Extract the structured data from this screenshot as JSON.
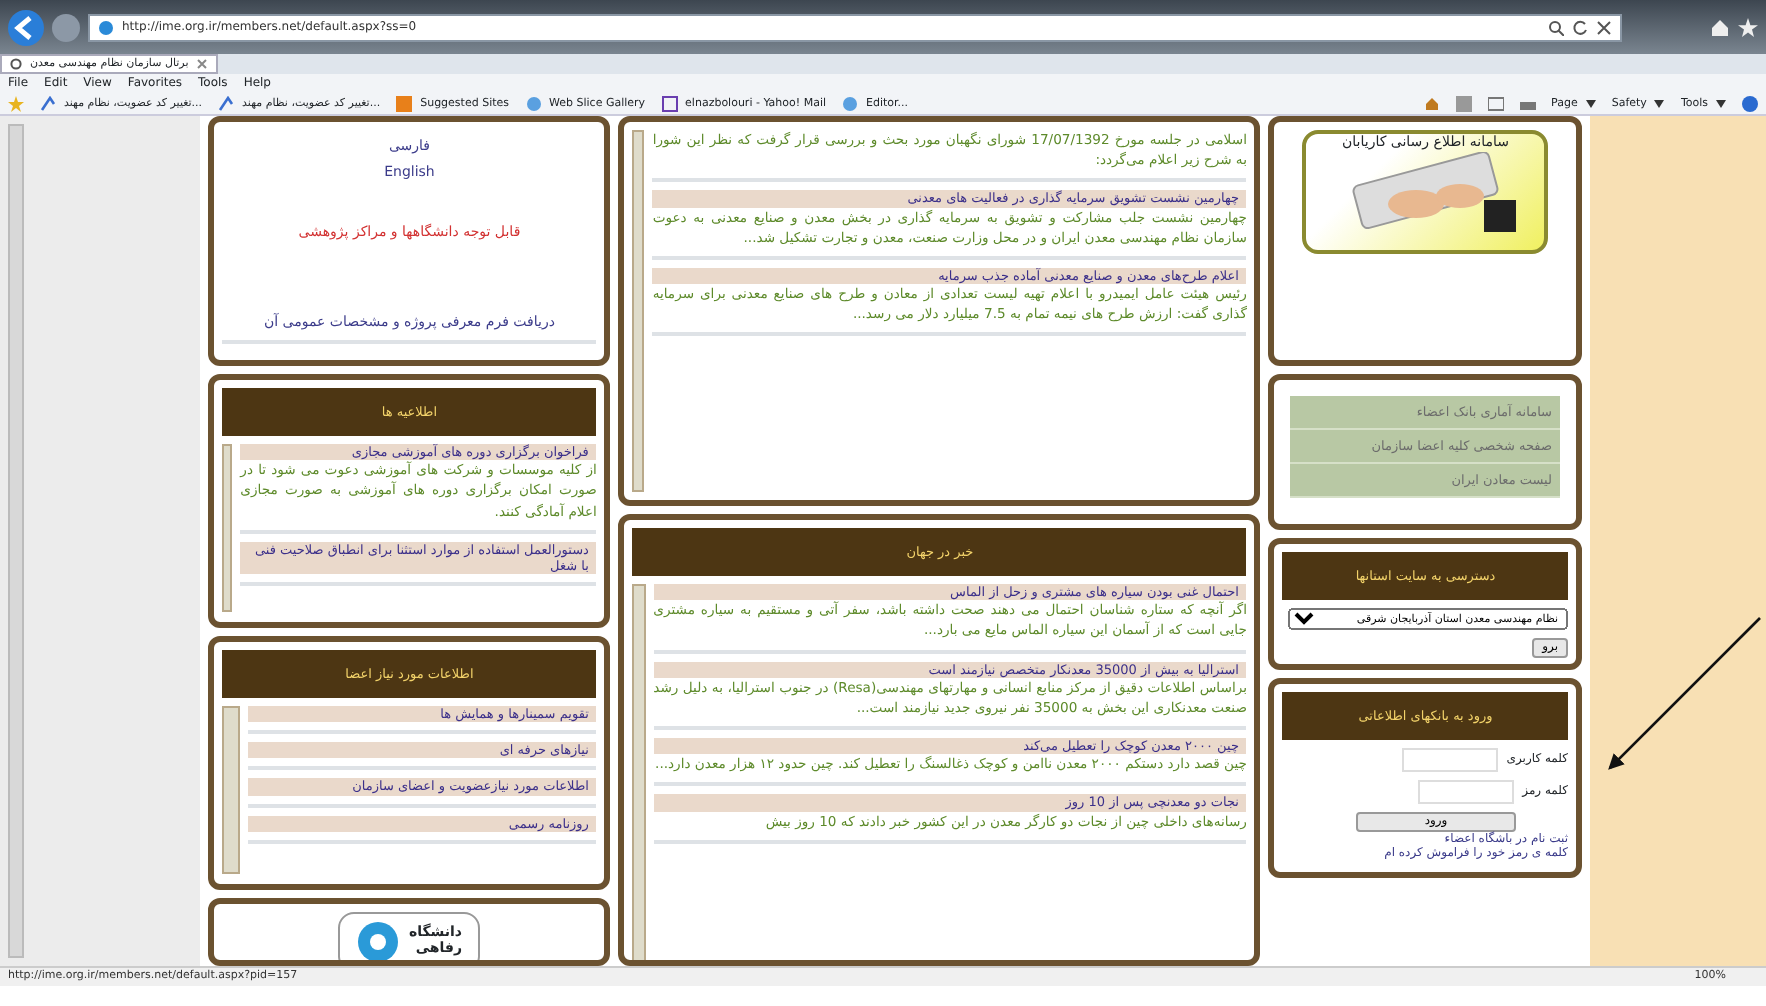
{
  "browser": {
    "address": "http://ime.org.ir/members.net/default.aspx?ss=0",
    "tab_title": "برتال سازمان نظام مهندسی معدن",
    "menu": [
      "Help",
      "Tools",
      "Favorites",
      "View",
      "Edit",
      "File"
    ],
    "favorites": [
      "Editor...",
      "elnazbolouri - Yahoo! Mail",
      "Web Slice Gallery",
      "Suggested Sites",
      "...تغییر کد عضویت، نظام مهند",
      "...تغییر کد عضویت، نظام مهند"
    ],
    "command_bar": [
      "Tools",
      "Safety",
      "Page"
    ],
    "status_url": "http://ime.org.ir/members.net/default.aspx?pid=157",
    "zoom": "100%"
  },
  "left_column": {
    "links": [
      {
        "text": "فارسی",
        "kind": "plain"
      },
      {
        "text": "English",
        "kind": "plain"
      },
      {
        "text": "قابل توجه دانشگاهها و مراکز پژوهشی",
        "kind": "alert"
      },
      {
        "text": "دریافت فرم معرفی پروژه و مشخصات عمومی آن",
        "kind": "plain"
      }
    ],
    "notices": {
      "title": "اطلاعیه ها",
      "items": [
        {
          "title": "فراخوان برگزاری دوره های آموزشی مجازی",
          "body": "از کلیه موسسات و شرکت های آموزشی دعوت می شود تا در صورت امکان برگزاری دوره های آموزشی به صورت مجازی اعلام آمادگی کنند."
        },
        {
          "title": "دستورالعمل استفاده از موارد استثنا برای انطباق صلاحیت فنی با شغل"
        }
      ]
    },
    "members": {
      "title": "اطلاعات مورد نیاز اعضا",
      "items": [
        "تقویم سمینارها و همایش ها",
        "نیازهای حرفه ای",
        "اطلاعات مورد نیازعضویت و اعضای سازمان",
        "روزنامه رسمی"
      ]
    },
    "logo_text": [
      "دانشگاه",
      "رفاهی"
    ]
  },
  "middle_column": {
    "news": {
      "items": [
        {
          "body": "اسلامی در جلسه مورخ 17/07/1392 شورای نگهبان مورد بحث و بررسی قرار گرفت که نظر این شورا به شرح زیر اعلام می‌گردد:"
        },
        {
          "title": "چهارمین نشست تشویق سرمایه گذاری در فعالیت های معدنی",
          "body": "چهارمین نشست جلب مشارکت و تشویق به سرمایه گذاری در بخش معدن و صنایع معدنی به دعوت سازمان نظام مهندسی معدن ایران و در محل وزارت صنعت، معدن و تجارت تشکیل شد..."
        },
        {
          "title": "اعلام طرح‌های معدن و صنایع معدنی آماده جذب سرمایه",
          "body": "رئیس هیئت عامل ایمیدرو با اعلام تهیه لیست تعدادی از معادن و طرح های صنایع معدنی برای سرمایه گذاری گفت: ارزش طرح های نیمه تمام به 7.5 میلیارد دلار می رسد..."
        }
      ]
    },
    "world_news": {
      "title": "خبر در جهان",
      "items": [
        {
          "title": "احتمال غنی بودن سیاره های مشتری و زحل از الماس",
          "body": "اگر آنچه که ستاره شناسان احتمال می دهند صحت داشته باشد، سفر آتی و مستقیم به سیاره مشتری جایی است که از آسمان این سیاره الماس مایع می بارد..."
        },
        {
          "title": "استرالیا به بیش از 35000 معدنکار متخصص نیازمند است",
          "body": "براساس اطلاعات دقیق از مرکز منابع انسانی و مهارتهای مهندسی(Resa) در جنوب استرالیا، به دلیل رشد صنعت معدنکاری این بخش به 35000 نفر نیروی جدید نیازمند است..."
        },
        {
          "title": "چین ۲۰۰۰ معدن کوچک را تعطیل می‌کند",
          "body": "چین قصد دارد دستکم ۲۰۰۰ معدن ناامن و کوچک ذغالسنگ را تعطیل کند. چین حدود ۱۲ هزار معدن دارد..."
        },
        {
          "title": "نجات دو معدنچی پس از 10 روز",
          "body": "رسانه‌های داخلی چین از نجات دو کارگر معدن در این کشور خبر دادند که 10 روز بیش"
        }
      ]
    }
  },
  "right_column": {
    "banner_text": "سامانه اطلاع رسانی کاریابان",
    "links": [
      "سامانه آماری بانک اعضاء",
      "صفحه شخصی کلیه اعضا سازمان",
      "لیست معادن ایران"
    ],
    "provinces": {
      "title": "دسترسی به سایت استانها",
      "selected": "نظام مهندسی معدن استان آذربایجان شرقی",
      "button": "برو"
    },
    "login": {
      "title": "ورود به بانکهای اطلاعاتی",
      "username_label": "کلمه کاربری",
      "password_label": "کلمه رمز",
      "button": "ورود",
      "links": [
        "ثبت نام در باشگاه اعضاء",
        "کلمه ی رمز خود را فراموش کرده ام"
      ]
    }
  }
}
